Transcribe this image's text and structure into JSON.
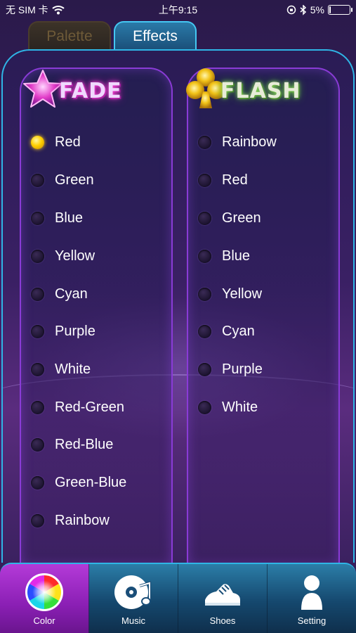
{
  "status_bar": {
    "carrier": "无 SIM 卡",
    "time": "上午9:15",
    "battery": "5%",
    "battery_level": 0.05
  },
  "tabs": [
    {
      "label": "Palette",
      "active": false
    },
    {
      "label": "Effects",
      "active": true
    }
  ],
  "fade": {
    "title": "FADE",
    "options": [
      "Red",
      "Green",
      "Blue",
      "Yellow",
      "Cyan",
      "Purple",
      "White",
      "Red-Green",
      "Red-Blue",
      "Green-Blue",
      "Rainbow"
    ],
    "selected": "Red"
  },
  "flash": {
    "title": "FLASH",
    "options": [
      "Rainbow",
      "Red",
      "Green",
      "Blue",
      "Yellow",
      "Cyan",
      "Purple",
      "White"
    ],
    "selected": null
  },
  "nav": [
    {
      "label": "Color",
      "icon": "color-wheel-icon",
      "active": true
    },
    {
      "label": "Music",
      "icon": "music-disc-icon",
      "active": false
    },
    {
      "label": "Shoes",
      "icon": "shoe-icon",
      "active": false
    },
    {
      "label": "Setting",
      "icon": "person-icon",
      "active": false
    }
  ],
  "colors": {
    "accent_blue": "#2fb5e6",
    "active_tab_purple": "#8a1fb4",
    "selected_radio": "#ffd000"
  }
}
